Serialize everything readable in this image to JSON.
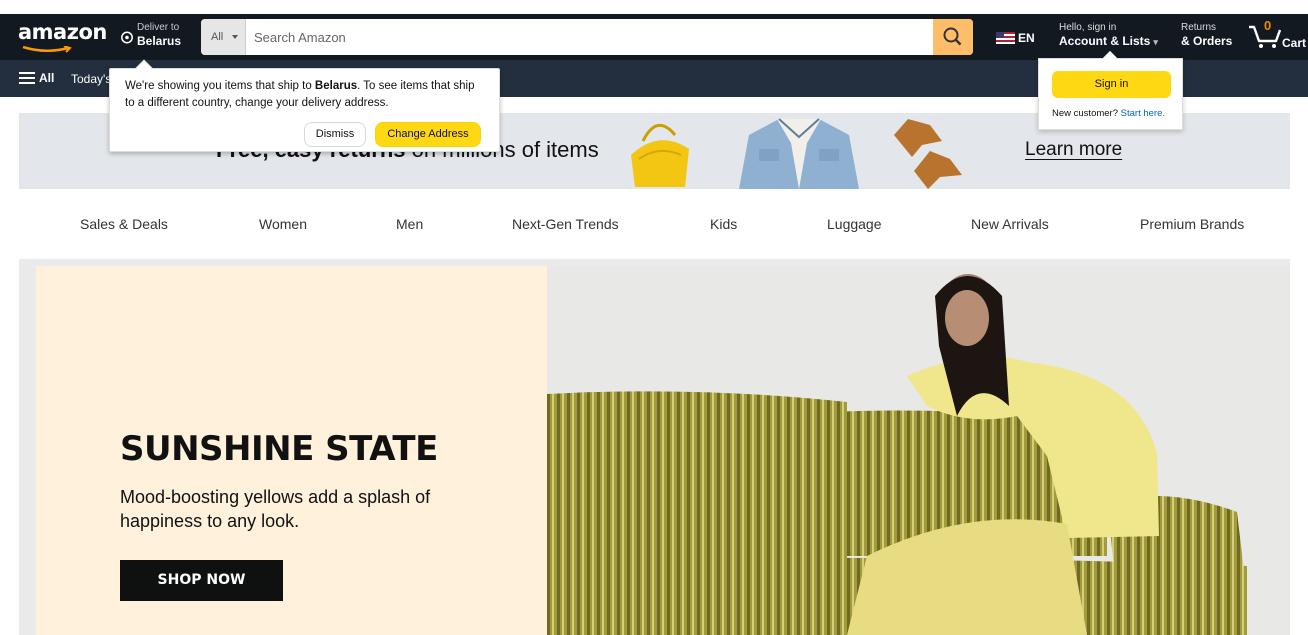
{
  "header": {
    "logo_text": "amazon",
    "deliver_line1": "Deliver to",
    "deliver_line2": "Belarus",
    "search_category": "All",
    "search_placeholder": "Search Amazon",
    "language": "EN",
    "account_line1": "Hello, sign in",
    "account_line2": "Account & Lists",
    "orders_line1": "Returns",
    "orders_line2": "& Orders",
    "cart_count": "0",
    "cart_label": "Cart"
  },
  "navbar": {
    "all_label": "All",
    "today_label": "Today's Deals"
  },
  "location_popover": {
    "msg_prefix": "We're showing you items that ship to ",
    "msg_country": "Belarus",
    "msg_suffix": ". To see items that ship to a different country, change your delivery address.",
    "dismiss_label": "Dismiss",
    "change_label": "Change Address"
  },
  "signin_flyout": {
    "signin_label": "Sign in",
    "new_customer": "New customer?",
    "start_here": "Start here."
  },
  "promo_banner": {
    "text_bold": "Free, easy returns",
    "text_rest": " on millions of items",
    "learn_more": "Learn more"
  },
  "categories": [
    "Sales & Deals",
    "Women",
    "Men",
    "Next-Gen Trends",
    "Kids",
    "Luggage",
    "New Arrivals",
    "Premium Brands"
  ],
  "hero": {
    "title": "SUNSHINE STATE",
    "subtitle": "Mood-boosting yellows add a splash of happiness to any look.",
    "cta": "SHOP NOW"
  },
  "colors": {
    "topbar": "#131921",
    "navbar": "#232f3e",
    "search_button": "#febd69",
    "button_yellow": "#ffd814",
    "link": "#0066c0",
    "hero_left_bg": "#fff1dc"
  }
}
